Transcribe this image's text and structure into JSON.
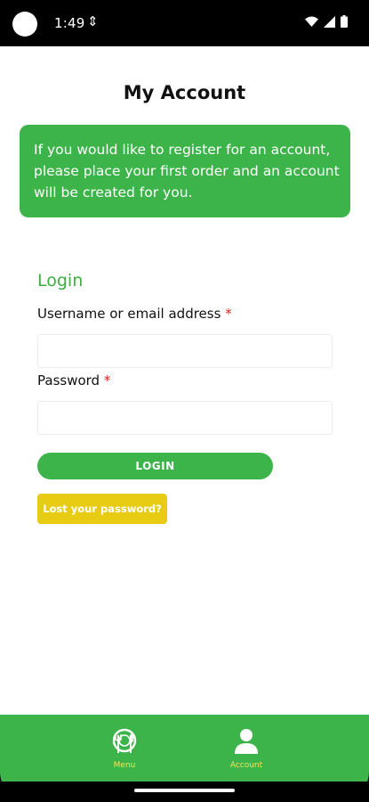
{
  "status_bar": {
    "time": "1:49",
    "usb_glyph": "⇕",
    "icons": [
      "wifi-icon",
      "signal-icon",
      "battery-icon"
    ]
  },
  "page": {
    "title": "My Account",
    "notice": "If you would like to register for an account, please place your first order and an account will be created for you."
  },
  "login": {
    "heading": "Login",
    "username_label": "Username or email address",
    "password_label": "Password",
    "required_marker": "*",
    "username_value": "",
    "password_value": "",
    "submit_label": "LOGIN",
    "lost_password_label": "Lost your password?"
  },
  "bottom_nav": {
    "items": [
      {
        "label": "Menu",
        "icon": "menu-plate-icon"
      },
      {
        "label": "Account",
        "icon": "user-icon"
      }
    ]
  },
  "colors": {
    "brand_green": "#3cb44a",
    "accent_yellow": "#e8cc14",
    "nav_label_yellow": "#f3e45a",
    "required_red": "#e02020"
  }
}
